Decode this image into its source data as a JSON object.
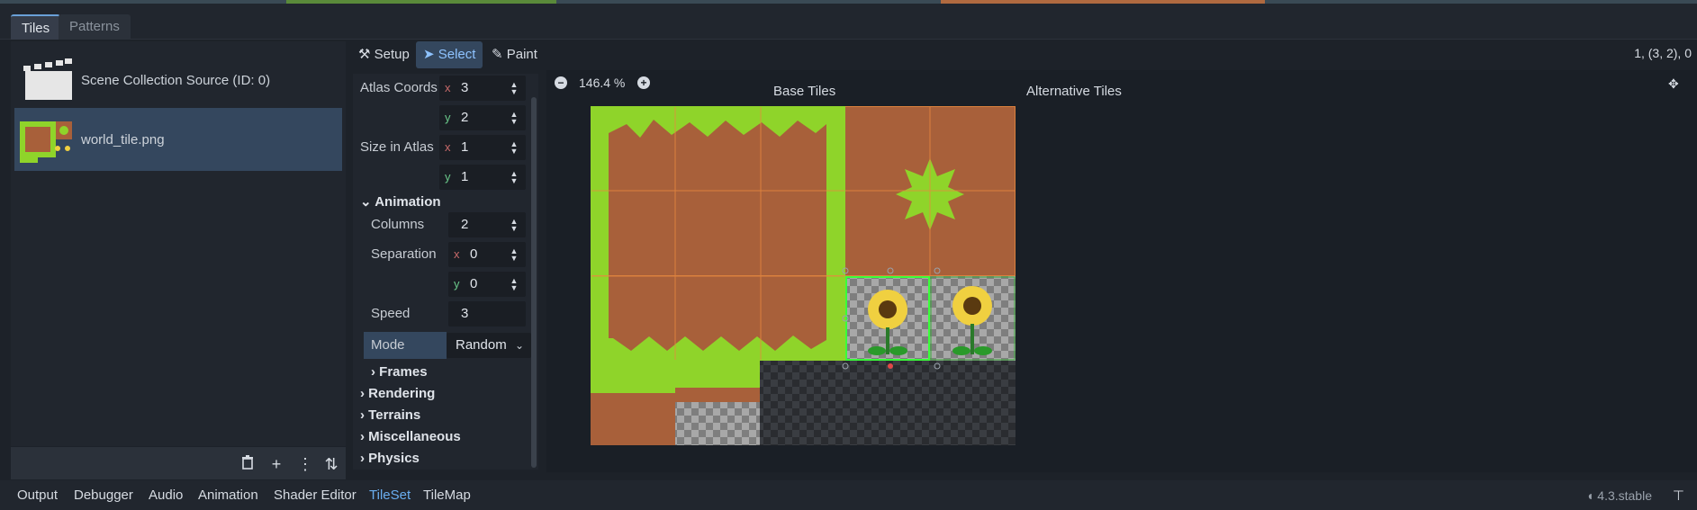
{
  "panel_tabs": [
    {
      "label": "Tiles",
      "active": true
    },
    {
      "label": "Patterns",
      "active": false
    }
  ],
  "sources": [
    {
      "label": "Scene Collection Source (ID: 0)",
      "selected": false
    },
    {
      "label": "world_tile.png",
      "selected": true
    }
  ],
  "left_toolbar_icons": [
    "trash-icon",
    "add-icon",
    "more-vertical-icon",
    "sort-icon"
  ],
  "toolbar": {
    "setup_label": "Setup",
    "select_label": "Select",
    "paint_label": "Paint",
    "coordinates": "1, (3, 2), 0"
  },
  "inspector": {
    "atlas_coords_label": "Atlas Coords",
    "atlas_coords": {
      "x": "3",
      "y": "2"
    },
    "size_in_atlas_label": "Size in Atlas",
    "size_in_atlas": {
      "x": "1",
      "y": "1"
    },
    "animation_label": "Animation",
    "columns_label": "Columns",
    "columns": "2",
    "separation_label": "Separation",
    "separation": {
      "x": "0",
      "y": "0"
    },
    "speed_label": "Speed",
    "speed": "3",
    "mode_label": "Mode",
    "mode": "Random",
    "frames_label": "Frames",
    "sections": [
      "Rendering",
      "Terrains",
      "Miscellaneous",
      "Physics"
    ],
    "axis_x": "x",
    "axis_y": "y"
  },
  "viewport": {
    "zoom": "146.4 %",
    "base_tiles_label": "Base Tiles",
    "alternative_tiles_label": "Alternative Tiles"
  },
  "bottom_tabs": [
    {
      "label": "Output",
      "active": false
    },
    {
      "label": "Debugger",
      "active": false
    },
    {
      "label": "Audio",
      "active": false
    },
    {
      "label": "Animation",
      "active": false
    },
    {
      "label": "Shader Editor",
      "active": false
    },
    {
      "label": "TileSet",
      "active": true
    },
    {
      "label": "TileMap",
      "active": false
    }
  ],
  "version": "4.3.stable",
  "colors": {
    "accent": "#6aaef0",
    "selection": "#34475e",
    "grass": "#8fd42a",
    "dirt": "#a8603a",
    "grid_line": "#e88a40"
  }
}
